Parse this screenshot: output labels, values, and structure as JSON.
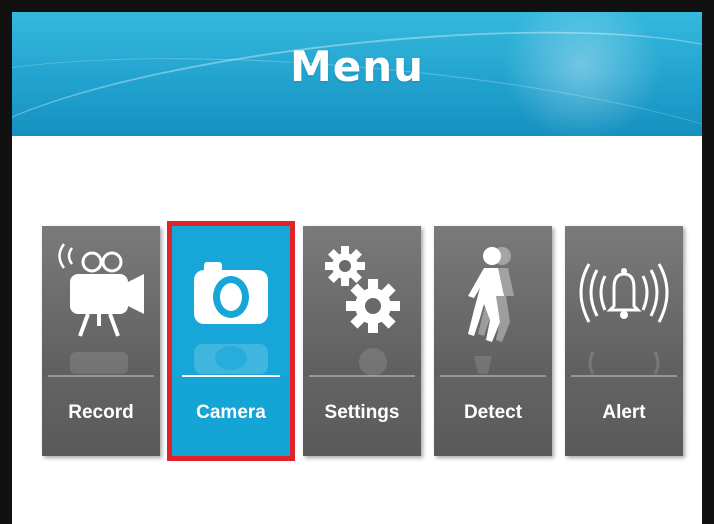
{
  "header": {
    "title": "Menu"
  },
  "menu": {
    "items": [
      {
        "id": "record",
        "label": "Record",
        "icon": "video-camera-icon",
        "selected": false
      },
      {
        "id": "camera",
        "label": "Camera",
        "icon": "camera-icon",
        "selected": true
      },
      {
        "id": "settings",
        "label": "Settings",
        "icon": "gears-icon",
        "selected": false
      },
      {
        "id": "detect",
        "label": "Detect",
        "icon": "walking-person-icon",
        "selected": false
      },
      {
        "id": "alert",
        "label": "Alert",
        "icon": "bell-alarm-icon",
        "selected": false
      }
    ]
  },
  "colors": {
    "header": "#22a3cf",
    "tile": "#666666",
    "selected_tile": "#15a4d6",
    "selection_border": "#e0222a"
  }
}
